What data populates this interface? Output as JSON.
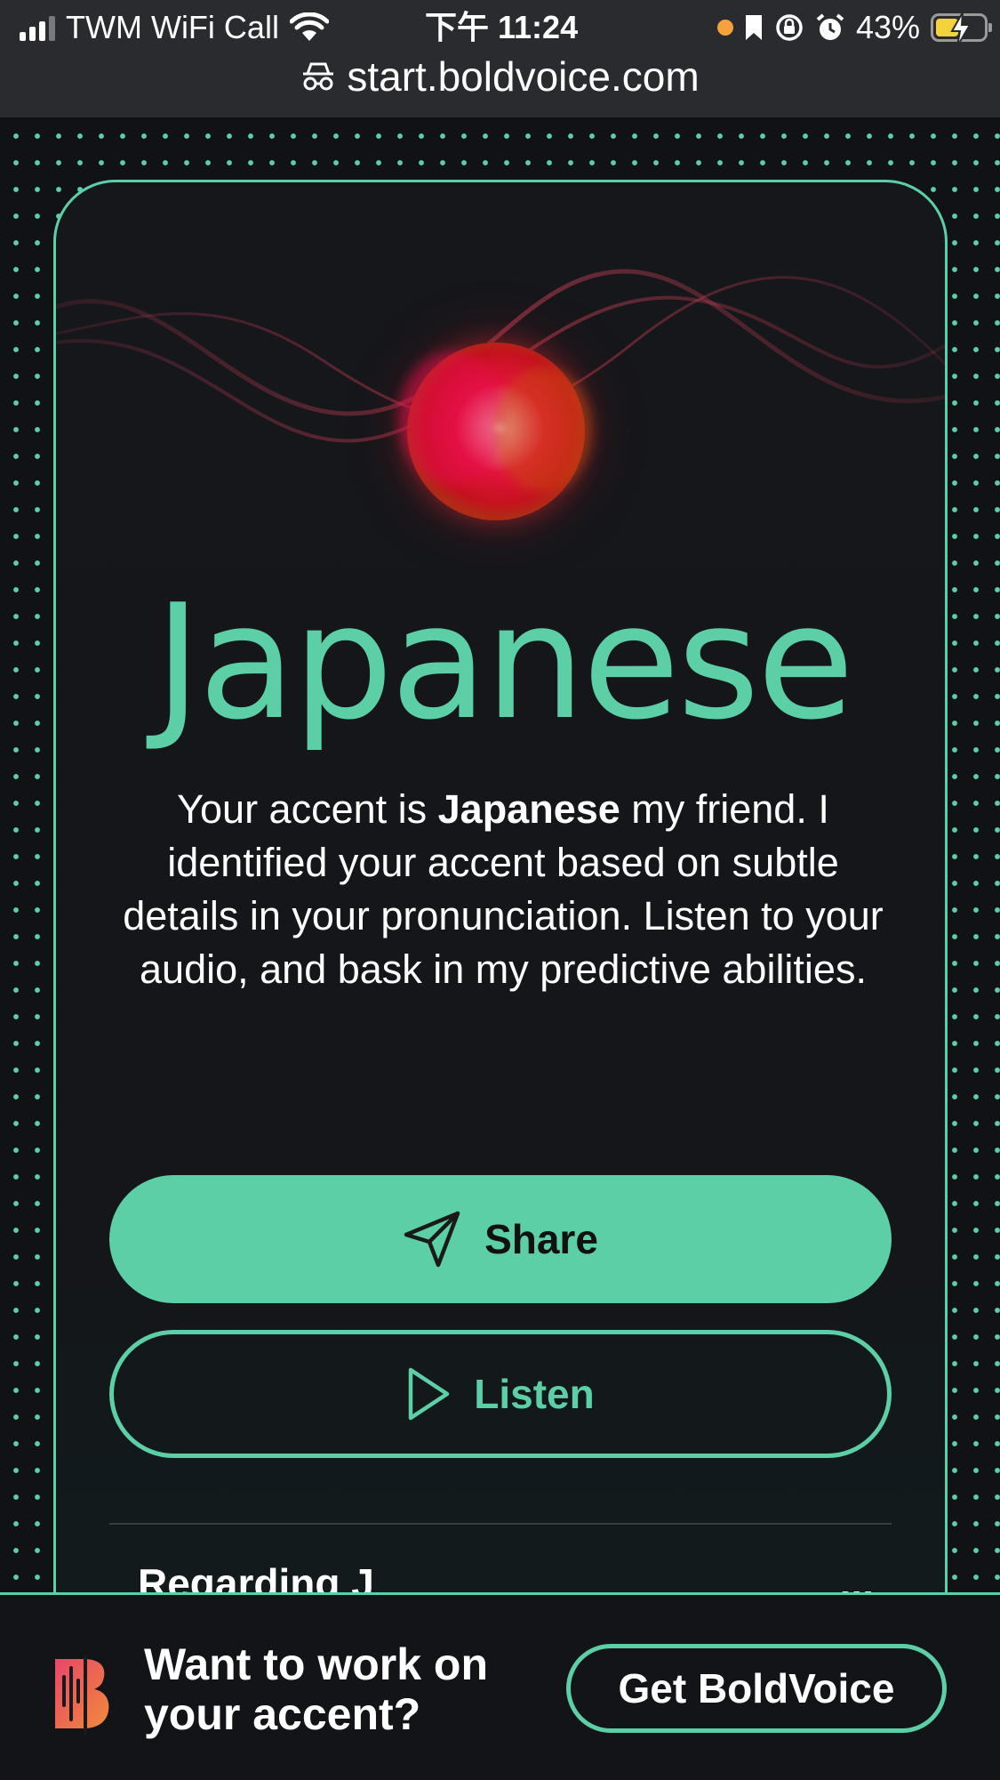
{
  "status_bar": {
    "carrier": "TWM WiFi Call",
    "time": "下午 11:24",
    "battery": "43%",
    "battery_level": 0.43
  },
  "url_bar": {
    "url": "start.boldvoice.com"
  },
  "result": {
    "accent": "Japanese",
    "description": {
      "before": "Your accent is ",
      "emphasis": "Japanese",
      "after": " my friend. I identified your accent based on subtle details in your pronunciation. Listen to your audio, and bask in my predictive abilities."
    },
    "share_label": "Share",
    "listen_label": "Listen",
    "cut_off_heading_start": "Regarding J",
    "cut_off_heading_end": "..."
  },
  "promo": {
    "line1": "Want to work on",
    "line2": "your accent?",
    "cta_label": "Get BoldVoice"
  },
  "colors": {
    "accent": "#5ccfa6",
    "background": "#111215",
    "orb": "#e2143c",
    "logo_gradient": [
      "#e8466a",
      "#f08a3a"
    ]
  }
}
